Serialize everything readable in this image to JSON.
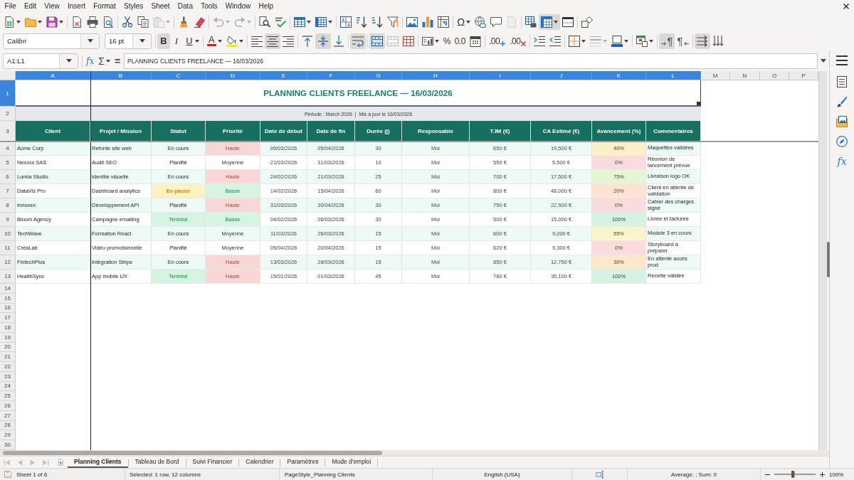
{
  "menu_bar": {
    "items": [
      "File",
      "Edit",
      "View",
      "Insert",
      "Format",
      "Styles",
      "Sheet",
      "Data",
      "Tools",
      "Window",
      "Help"
    ]
  },
  "standard_toolbar": {
    "buttons": [
      {
        "on": false,
        "disabled": false
      },
      {
        "on": false,
        "disabled": false
      },
      {
        "on": false,
        "disabled": false
      },
      {
        "on": false,
        "disabled": false
      },
      {
        "on": false,
        "disabled": false
      },
      {
        "on": false,
        "disabled": false
      },
      {
        "on": false,
        "disabled": false
      },
      {
        "on": false,
        "disabled": false
      },
      {
        "on": false,
        "disabled": true
      },
      {
        "on": false,
        "disabled": false
      },
      {
        "on": false,
        "disabled": false
      },
      {
        "on": false,
        "disabled": true
      },
      {
        "on": false,
        "disabled": true
      },
      {
        "on": false,
        "disabled": false
      },
      {
        "on": false,
        "disabled": false
      },
      {
        "on": false,
        "disabled": false
      },
      {
        "on": false,
        "disabled": false
      },
      {
        "on": false,
        "disabled": false
      },
      {
        "on": false,
        "disabled": false
      },
      {
        "on": false,
        "disabled": false
      },
      {
        "on": false,
        "disabled": false
      },
      {
        "on": false,
        "disabled": false
      },
      {
        "on": false,
        "disabled": false
      },
      {
        "on": false,
        "disabled": false
      },
      {
        "label": "Ω",
        "on": false,
        "disabled": false
      },
      {
        "on": false,
        "disabled": false
      },
      {
        "on": false,
        "disabled": false
      },
      {
        "on": false,
        "disabled": true
      },
      {
        "on": false,
        "disabled": false
      },
      {
        "on": true,
        "disabled": false
      },
      {
        "on": false,
        "disabled": false
      },
      {
        "on": false,
        "disabled": false
      }
    ]
  },
  "formatting_toolbar": {
    "font_name": "Calibri",
    "font_size": "16 pt",
    "buttons": [
      {
        "label": "B",
        "on": true,
        "disabled": false
      },
      {
        "label": "I",
        "on": false,
        "disabled": false
      },
      {
        "label": "U",
        "on": false,
        "disabled": false
      },
      {
        "label": "A",
        "on": false,
        "disabled": false
      },
      {
        "on": false,
        "disabled": false
      },
      {
        "on": false,
        "disabled": false
      },
      {
        "on": true,
        "disabled": false
      },
      {
        "on": false,
        "disabled": false
      },
      {
        "on": false,
        "disabled": false
      },
      {
        "on": true,
        "disabled": false
      },
      {
        "on": false,
        "disabled": false
      },
      {
        "on": true,
        "disabled": false
      },
      {
        "on": true,
        "disabled": false
      },
      {
        "on": false,
        "disabled": true
      },
      {
        "on": false,
        "disabled": false
      },
      {
        "on": false,
        "disabled": false
      },
      {
        "label": "%",
        "on": false,
        "disabled": false
      },
      {
        "label": "0.0",
        "on": false,
        "disabled": false
      },
      {
        "on": false,
        "disabled": false
      },
      {
        "label": ".00",
        "on": false,
        "disabled": false
      },
      {
        "label": ".00",
        "on": false,
        "disabled": false
      },
      {
        "on": false,
        "disabled": false
      },
      {
        "on": false,
        "disabled": false
      },
      {
        "on": false,
        "disabled": false
      },
      {
        "on": false,
        "disabled": true
      },
      {
        "on": false,
        "disabled": false
      },
      {
        "on": false,
        "disabled": false
      },
      {
        "label": "¶",
        "on": true,
        "disabled": false
      },
      {
        "label": "¶",
        "on": false,
        "disabled": false
      },
      {
        "on": true,
        "disabled": false
      },
      {
        "on": false,
        "disabled": false
      }
    ]
  },
  "formula_bar": {
    "name_box": "A1:L1",
    "function_wizard": "fx",
    "sum": "Σ",
    "equals": "=",
    "content": "PLANNING CLIENTS FREELANCE — 16/03/2026"
  },
  "sheet": {
    "column_headers": [
      {
        "label": "A",
        "selected": true
      },
      {
        "label": "B",
        "selected": true
      },
      {
        "label": "C",
        "selected": true
      },
      {
        "label": "D",
        "selected": true
      },
      {
        "label": "E",
        "selected": true
      },
      {
        "label": "F",
        "selected": true
      },
      {
        "label": "G",
        "selected": true
      },
      {
        "label": "H",
        "selected": true
      },
      {
        "label": "I",
        "selected": true
      },
      {
        "label": "J",
        "selected": true
      },
      {
        "label": "K",
        "selected": true
      },
      {
        "label": "L",
        "selected": true
      },
      {
        "label": "M",
        "selected": false
      },
      {
        "label": "N",
        "selected": false
      },
      {
        "label": "O",
        "selected": false
      },
      {
        "label": "P",
        "selected": false
      }
    ],
    "row_headers": [
      {
        "label": "1",
        "selected": true
      },
      {
        "label": "2",
        "selected": false
      },
      {
        "label": "3",
        "selected": false
      },
      {
        "label": "4",
        "selected": false
      },
      {
        "label": "5",
        "selected": false
      },
      {
        "label": "6",
        "selected": false
      },
      {
        "label": "7",
        "selected": false
      },
      {
        "label": "8",
        "selected": false
      },
      {
        "label": "9",
        "selected": false
      },
      {
        "label": "10",
        "selected": false
      },
      {
        "label": "11",
        "selected": false
      },
      {
        "label": "12",
        "selected": false
      },
      {
        "label": "13",
        "selected": false
      },
      {
        "label": "14",
        "selected": false
      },
      {
        "label": "15",
        "selected": false
      },
      {
        "label": "16",
        "selected": false
      },
      {
        "label": "17",
        "selected": false
      },
      {
        "label": "18",
        "selected": false
      },
      {
        "label": "19",
        "selected": false
      },
      {
        "label": "20",
        "selected": false
      },
      {
        "label": "21",
        "selected": false
      },
      {
        "label": "22",
        "selected": false
      },
      {
        "label": "23",
        "selected": false
      },
      {
        "label": "24",
        "selected": false
      },
      {
        "label": "25",
        "selected": false
      },
      {
        "label": "26",
        "selected": false
      },
      {
        "label": "27",
        "selected": false
      },
      {
        "label": "28",
        "selected": false
      },
      {
        "label": "29",
        "selected": false
      },
      {
        "label": "30",
        "selected": false
      }
    ],
    "title": {
      "text": "PLANNING CLIENTS FREELANCE — 16/03/2026",
      "selected": true
    },
    "subtitle": "Période : March 2026  |  Mis à jour le 16/03/2026",
    "table": {
      "columns": [
        "Client",
        "Projet / Mission",
        "Statut",
        "Priorité",
        "Date de début",
        "Date de fin",
        "Durée (j)",
        "Responsable",
        "TJM (€)",
        "CA Estimé (€)",
        "Avancement (%)",
        "Commentaires"
      ],
      "rows": [
        {
          "client": "Acme Corp",
          "project": "Refonte site web",
          "status": {
            "text": "En cours",
            "kind": "plain"
          },
          "priority": {
            "text": "Haute",
            "kind": "high"
          },
          "start": "06/03/2026",
          "end": "05/04/2026",
          "days": "30",
          "owner": "Moi",
          "rate": "650 €",
          "revenue": "19,500 €",
          "progress": {
            "text": "40%",
            "color": "#fdefc6"
          },
          "comment": "Maquettes validées"
        },
        {
          "client": "Nexora SAS",
          "project": "Audit SEO",
          "status": {
            "text": "Planifié",
            "kind": "plain"
          },
          "priority": {
            "text": "Moyenne",
            "kind": "medium"
          },
          "start": "21/03/2026",
          "end": "31/03/2026",
          "days": "10",
          "owner": "Moi",
          "rate": "550 €",
          "revenue": "5,500 €",
          "progress": {
            "text": "0%",
            "color": "#fadcdc"
          },
          "comment": "Réunion de lancement prévue"
        },
        {
          "client": "Lumia Studio",
          "project": "Identité visuelle",
          "status": {
            "text": "En cours",
            "kind": "plain"
          },
          "priority": {
            "text": "Haute",
            "kind": "high"
          },
          "start": "24/02/2026",
          "end": "21/03/2026",
          "days": "25",
          "owner": "Moi",
          "rate": "700 €",
          "revenue": "17,500 €",
          "progress": {
            "text": "75%",
            "color": "#e6f5d2"
          },
          "comment": "Livraison logo OK"
        },
        {
          "client": "DataViz Pro",
          "project": "Dashboard analytics",
          "status": {
            "text": "En pause",
            "kind": "paused"
          },
          "priority": {
            "text": "Basse",
            "kind": "low"
          },
          "start": "14/02/2026",
          "end": "15/04/2026",
          "days": "60",
          "owner": "Moi",
          "rate": "800 €",
          "revenue": "48,000 €",
          "progress": {
            "text": "20%",
            "color": "#fde3d0"
          },
          "comment": "Client en attente de validation"
        },
        {
          "client": "Innovex",
          "project": "Développement API",
          "status": {
            "text": "Planifié",
            "kind": "plain"
          },
          "priority": {
            "text": "Haute",
            "kind": "high"
          },
          "start": "31/03/2026",
          "end": "30/04/2026",
          "days": "30",
          "owner": "Moi",
          "rate": "750 €",
          "revenue": "22,500 €",
          "progress": {
            "text": "0%",
            "color": "#fadcdc"
          },
          "comment": "Cahier des charges signé"
        },
        {
          "client": "Bloom Agency",
          "project": "Campagne emailing",
          "status": {
            "text": "Terminé",
            "kind": "done"
          },
          "priority": {
            "text": "Basse",
            "kind": "low"
          },
          "start": "04/02/2026",
          "end": "06/03/2026",
          "days": "30",
          "owner": "Moi",
          "rate": "500 €",
          "revenue": "15,000 €",
          "progress": {
            "text": "100%",
            "color": "#d4f3e1"
          },
          "comment": "Livrée et facturée"
        },
        {
          "client": "TechWave",
          "project": "Formation React",
          "status": {
            "text": "En cours",
            "kind": "plain"
          },
          "priority": {
            "text": "Moyenne",
            "kind": "medium"
          },
          "start": "11/03/2026",
          "end": "26/03/2026",
          "days": "15",
          "owner": "Moi",
          "rate": "600 €",
          "revenue": "9,000 €",
          "progress": {
            "text": "55%",
            "color": "#fbf5cb"
          },
          "comment": "Module 3 en cours"
        },
        {
          "client": "CréaLab",
          "project": "Vidéo promotionnelle",
          "status": {
            "text": "Planifié",
            "kind": "plain"
          },
          "priority": {
            "text": "Moyenne",
            "kind": "medium"
          },
          "start": "05/04/2026",
          "end": "20/04/2026",
          "days": "15",
          "owner": "Moi",
          "rate": "620 €",
          "revenue": "9,300 €",
          "progress": {
            "text": "0%",
            "color": "#fadcdc"
          },
          "comment": "Storyboard à préparer"
        },
        {
          "client": "FintechPlus",
          "project": "Intégration Stripe",
          "status": {
            "text": "En cours",
            "kind": "plain"
          },
          "priority": {
            "text": "Haute",
            "kind": "high"
          },
          "start": "13/03/2026",
          "end": "28/03/2026",
          "days": "15",
          "owner": "Moi",
          "rate": "850 €",
          "revenue": "12,750 €",
          "progress": {
            "text": "30%",
            "color": "#fde8c9"
          },
          "comment": "En attente accès prod"
        },
        {
          "client": "HealthSync",
          "project": "App mobile UX",
          "status": {
            "text": "Terminé",
            "kind": "done"
          },
          "priority": {
            "text": "Haute",
            "kind": "high"
          },
          "start": "15/01/2026",
          "end": "01/03/2026",
          "days": "45",
          "owner": "Moi",
          "rate": "780 €",
          "revenue": "35,100 €",
          "progress": {
            "text": "100%",
            "color": "#d4f3e1"
          },
          "comment": "Recette validée"
        }
      ]
    }
  },
  "sheet_navigation": {
    "buttons": [
      {
        "disabled": true
      },
      {
        "disabled": true
      },
      {
        "disabled": true
      },
      {
        "disabled": true
      }
    ]
  },
  "sheet_tabs": [
    {
      "label": "Planning Clients",
      "selected": true
    },
    {
      "label": "Tableau de Bord",
      "selected": false
    },
    {
      "label": "Suivi Financier",
      "selected": false
    },
    {
      "label": "Calendrier",
      "selected": false
    },
    {
      "label": "Paramètres",
      "selected": false
    },
    {
      "label": "Mode d'emploi",
      "selected": false
    }
  ],
  "sidebar": {
    "buttons": [
      {
        "selected": false
      },
      {
        "selected": false
      },
      {
        "selected": false
      },
      {
        "selected": false
      },
      {
        "label": "fx",
        "selected": false
      }
    ]
  },
  "status_bar": {
    "sheet": "Sheet 1 of 6",
    "selection": "Selected: 1 row, 12 columns",
    "page_style": "PageStyle_Planning Clients",
    "language": "English (USA)",
    "summary": "Average: ; Sum: 0",
    "zoom_slider": {
      "level": 0.45
    },
    "zoom": "100%"
  }
}
